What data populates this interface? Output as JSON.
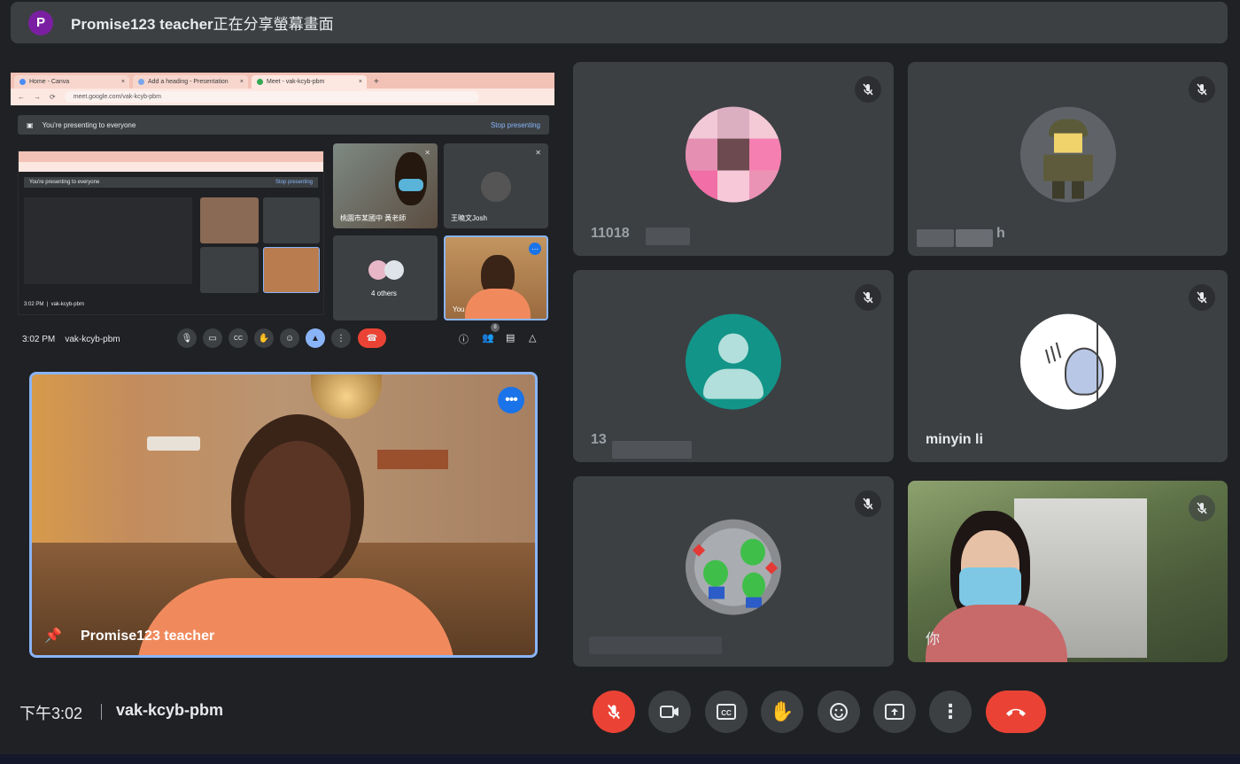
{
  "banner": {
    "avatar_letter": "P",
    "presenter_name": "Promise123 teacher",
    "status_text": "正在分享螢幕畫面"
  },
  "shared_screen": {
    "tabs": [
      "Home - Canva",
      "Add a heading - Presentation",
      "Meet - vak-kcyb-pbm"
    ],
    "url": "meet.google.com/vak-kcyb-pbm",
    "presenting_text": "You're presenting to everyone",
    "stop_label": "Stop presenting",
    "tiles": [
      {
        "label": "桃園市某國中 黃老師"
      },
      {
        "label": "王曉文Josh"
      },
      {
        "label": "4 others"
      },
      {
        "label": "You"
      }
    ],
    "nested_time": "3:02 PM",
    "nested_code": "vak-kcyb-pbm",
    "time": "3:02 PM",
    "meeting_code": "vak-kcyb-pbm",
    "people_count": "8"
  },
  "presenter_tile": {
    "name": "Promise123 teacher"
  },
  "participants": [
    {
      "name": "11018",
      "obscured": true
    },
    {
      "name": "h",
      "obscured": true
    },
    {
      "name": "13",
      "obscured": true
    },
    {
      "name": "minyin li",
      "obscured": false
    },
    {
      "name": "",
      "obscured": true
    },
    {
      "name": "你",
      "obscured": false
    }
  ],
  "footer": {
    "time": "下午3:02",
    "meeting_code": "vak-kcyb-pbm"
  },
  "colors": {
    "background": "#202124",
    "tile": "#3c4043",
    "accent_blue": "#8ab4f8",
    "danger_red": "#ea4335",
    "teal_avatar": "#129488"
  }
}
